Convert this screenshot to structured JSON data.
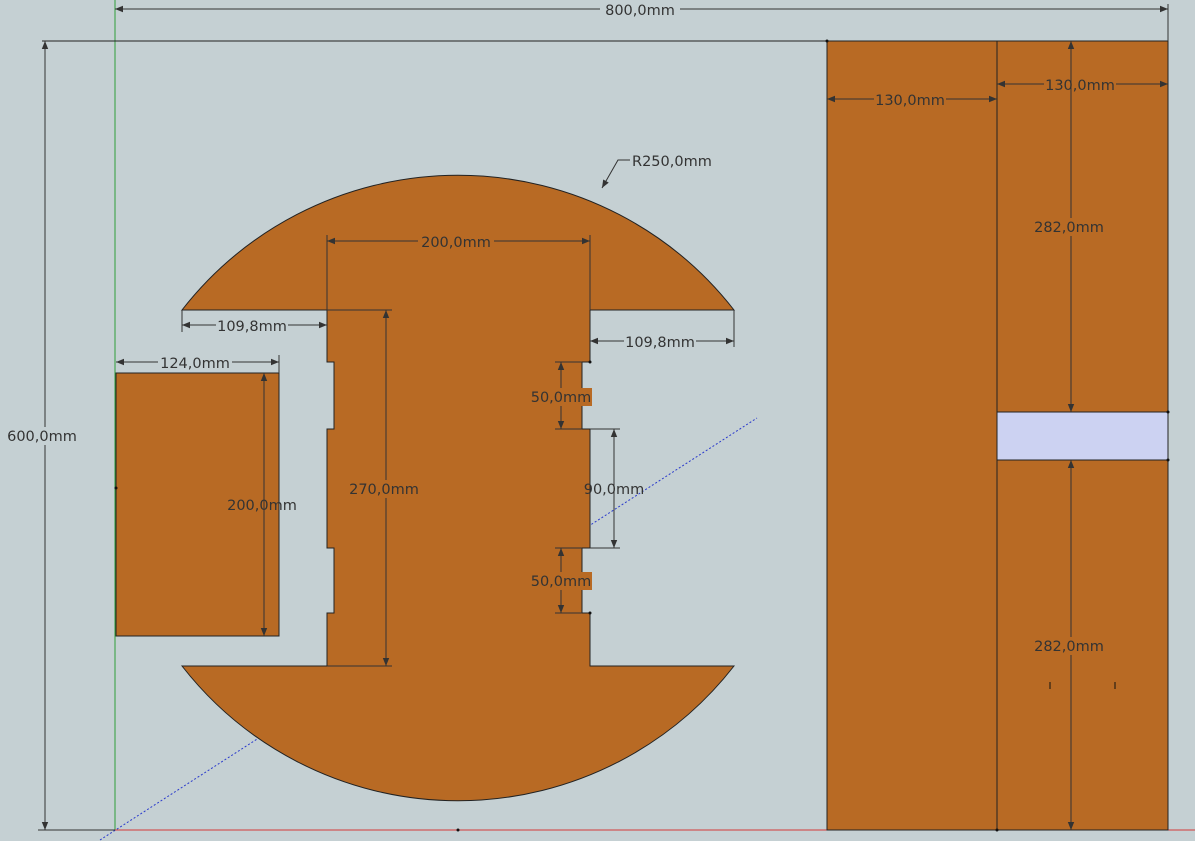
{
  "colors": {
    "background": "#c5d0d3",
    "wood": "#b86a24",
    "slot_highlight": "#ccd2f2",
    "axis_green": "#2e9e3a",
    "axis_red": "#d23a3a",
    "axis_blue": "#2a3acc",
    "dimension_line": "#333333"
  },
  "dimensions": {
    "overall_width": "800,0mm",
    "overall_height": "600,0mm",
    "radius": "R250,0mm",
    "neck_width": "200,0mm",
    "shoulder_left": "109,8mm",
    "shoulder_right": "109,8mm",
    "neck_height": "270,0mm",
    "notch_top": "50,0mm",
    "notch_gap": "90,0mm",
    "notch_bottom": "50,0mm",
    "small_panel_width": "124,0mm",
    "small_panel_height": "200,0mm",
    "board_left_width": "130,0mm",
    "board_right_width": "130,0mm",
    "board_upper_height": "282,0mm",
    "board_lower_height": "282,0mm"
  }
}
